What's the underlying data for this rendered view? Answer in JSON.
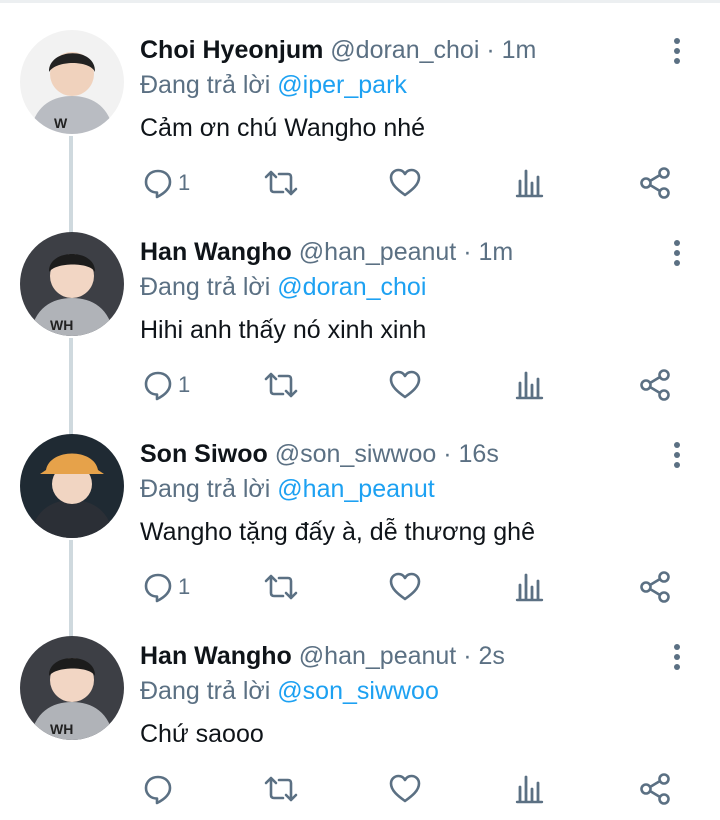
{
  "colors": {
    "name": "#0f1419",
    "secondary": "#5b7083",
    "mention": "#1da1f2",
    "thread_line": "#cfd9de"
  },
  "tweets": [
    {
      "name": "Choi Hyeonjum",
      "handle": "@doran_choi",
      "separator": "·",
      "time": "1m",
      "reply_prefix": "Đang trả lời",
      "reply_to": "@iper_park",
      "text": "Cảm ơn chú Wangho nhé",
      "reply_count": "1"
    },
    {
      "name": "Han Wangho",
      "handle": "@han_peanut",
      "separator": "·",
      "time": "1m",
      "reply_prefix": "Đang trả lời",
      "reply_to": "@doran_choi",
      "text": "Hihi anh thấy nó xinh xinh",
      "reply_count": "1"
    },
    {
      "name": "Son Siwoo",
      "handle": "@son_siwwoo",
      "separator": "·",
      "time": "16s",
      "reply_prefix": "Đang trả lời",
      "reply_to": "@han_peanut",
      "text": "Wangho tặng đấy à, dễ thương ghê",
      "reply_count": "1"
    },
    {
      "name": "Han Wangho",
      "handle": "@han_peanut",
      "separator": "·",
      "time": "2s",
      "reply_prefix": "Đang trả lời",
      "reply_to": "@son_siwwoo",
      "text": "Chứ saooo",
      "reply_count": ""
    }
  ],
  "icons": {
    "more": "more-vertical-icon",
    "reply": "reply-icon",
    "retweet": "retweet-icon",
    "like": "heart-icon",
    "stats": "stats-icon",
    "share": "share-icon"
  }
}
